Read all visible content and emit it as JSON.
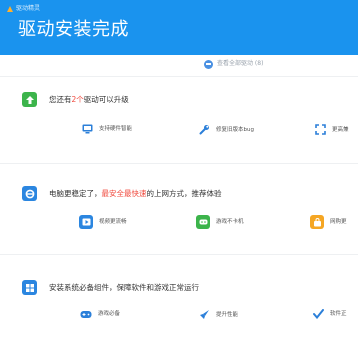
{
  "header": {
    "app_name": "驱动精灵",
    "title": "驱动安装完成"
  },
  "view_all": "查看全部驱动 (8)",
  "sections": [
    {
      "text_parts": [
        "您还有",
        "2个",
        "驱动可以升级"
      ],
      "items": [
        {
          "icon": "monitor-icon",
          "label": "支持硬件智能"
        },
        {
          "icon": "wrench-icon",
          "label": "修复旧版本bug"
        },
        {
          "icon": "expand-icon",
          "label": "更高兼"
        }
      ]
    },
    {
      "text_parts": [
        "电脑更稳定了，",
        "最安全最快速",
        "的上网方式，推荐体验"
      ],
      "items": [
        {
          "icon": "video-app-icon",
          "label": "视频更流畅"
        },
        {
          "icon": "game-app-icon",
          "label": "游戏不卡机"
        },
        {
          "icon": "shop-app-icon",
          "label": "网购更"
        }
      ]
    },
    {
      "text_parts": [
        "安装系统必备组件，保障软件和游戏正常运行"
      ],
      "items": [
        {
          "icon": "gamepad-icon",
          "label": "游戏必备"
        },
        {
          "icon": "rocket-icon",
          "label": "提升性能"
        },
        {
          "icon": "check-icon",
          "label": "软件正"
        }
      ]
    }
  ],
  "colors": {
    "header_bg": "#1a93ee",
    "accent_red": "#f04a3e",
    "icon_blue": "#2b7fd9",
    "icon_green": "#3cb44b"
  }
}
